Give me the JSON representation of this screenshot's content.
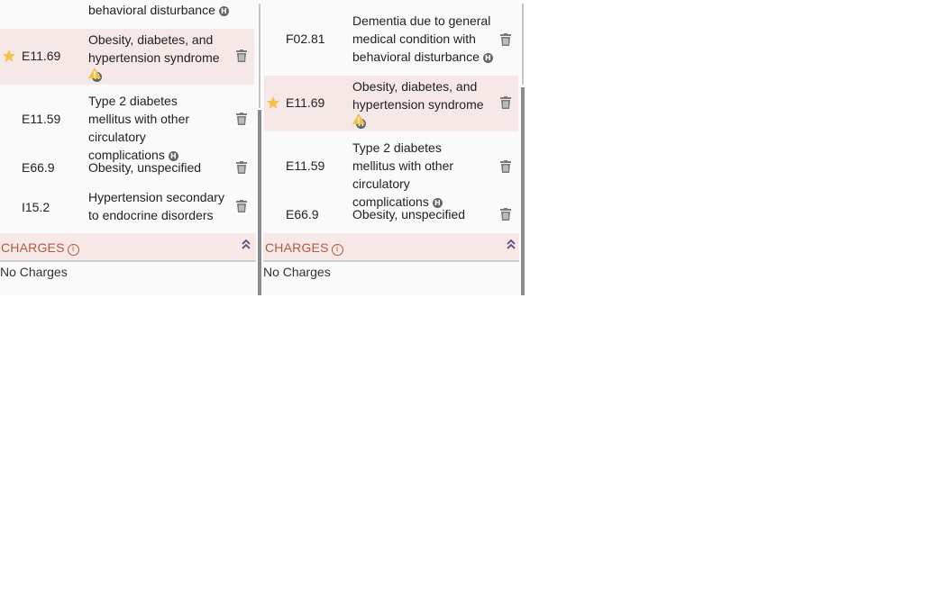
{
  "left_panel": {
    "partial_row_text": "behavioral disturbance",
    "rows": [
      {
        "code": "E11.69",
        "desc": "Obesity, diabetes, and hypertension syndrome"
      },
      {
        "code": "E11.59",
        "desc": "Type 2 diabetes mellitus with other circulatory complications"
      },
      {
        "code": "E66.9",
        "desc": "Obesity, unspecified"
      },
      {
        "code": "I15.2",
        "desc": "Hypertension secondary to endocrine disorders"
      }
    ],
    "charges_label": "CHARGES",
    "no_charges_text": "No Charges"
  },
  "right_panel": {
    "rows": [
      {
        "code": "F02.81",
        "desc": "Dementia due to general medical condition with behavioral disturbance"
      },
      {
        "code": "E11.69",
        "desc": "Obesity, diabetes, and hypertension syndrome"
      },
      {
        "code": "E11.59",
        "desc": "Type 2 diabetes mellitus with other circulatory complications"
      },
      {
        "code": "E66.9",
        "desc": "Obesity, unspecified"
      }
    ],
    "charges_label": "CHARGES",
    "no_charges_text": "No Charges"
  },
  "icons": {
    "hcc_badge_letter": "H",
    "info_glyph": "i"
  },
  "colors": {
    "highlight_row": "#f5e8e6",
    "charges_text": "#b25a3a",
    "star": "#f3c04a",
    "warning": "#f3c04a",
    "trash": "#7a7a7a"
  }
}
